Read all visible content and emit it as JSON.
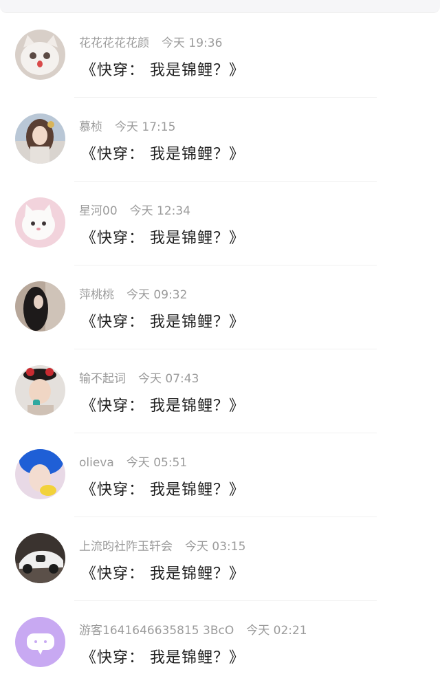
{
  "comments": [
    {
      "username": "花花花花花颜",
      "time": "今天 19:36",
      "message": "《快穿： 我是锦鲤？》",
      "avatar_icon": "white-cat-avatar-icon"
    },
    {
      "username": "慕桢",
      "time": "今天 17:15",
      "message": "《快穿： 我是锦鲤？》",
      "avatar_icon": "anime-girl-avatar-icon"
    },
    {
      "username": "星河00",
      "time": "今天 12:34",
      "message": "《快穿： 我是锦鲤？》",
      "avatar_icon": "white-kitten-avatar-icon"
    },
    {
      "username": "萍桃桃",
      "time": "今天 09:32",
      "message": "《快穿： 我是锦鲤？》",
      "avatar_icon": "dark-hair-girl-avatar-icon"
    },
    {
      "username": "输不起词",
      "time": "今天 07:43",
      "message": "《快穿： 我是锦鲤？》",
      "avatar_icon": "child-with-bow-avatar-icon"
    },
    {
      "username": "olieva",
      "time": "今天 05:51",
      "message": "《快穿： 我是锦鲤？》",
      "avatar_icon": "blue-hair-avatar-icon"
    },
    {
      "username": "上流昀社阼玉轩会",
      "time": "今天 03:15",
      "message": "《快穿： 我是锦鲤？》",
      "avatar_icon": "race-car-avatar-icon"
    },
    {
      "username": "游客1641646635815 3BcO",
      "time": "今天 02:21",
      "message": "《快穿： 我是锦鲤？》",
      "avatar_icon": "chat-bubble-avatar-icon"
    }
  ]
}
